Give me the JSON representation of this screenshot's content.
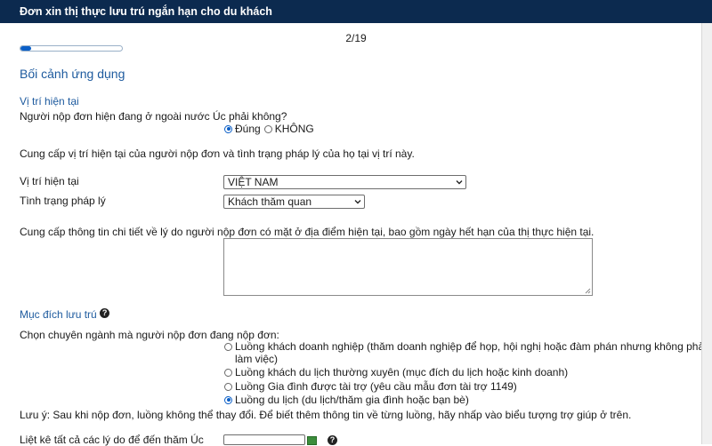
{
  "window": {
    "title": "Đơn xin thị thực lưu trú ngắn hạn cho du khách"
  },
  "progress": {
    "value": 0.105,
    "page": "2/19",
    "accent": "#0b5fc7"
  },
  "section": {
    "title": "Bối cảnh ứng dụng"
  },
  "location": {
    "heading": "Vị trí hiện tại",
    "question": "Người nộp đơn hiện đang ở ngoài nước Úc phải không?",
    "yes_label": "Đúng",
    "no_label": "KHÔNG",
    "selected": "yes",
    "instruction": "Cung cấp vị trí hiện tại của người nộp đơn và tình trạng pháp lý của họ tại vị trí này.",
    "location_label": "Vị trí hiện tại",
    "location_value": "VIỆT NAM",
    "status_label": "Tình trạng pháp lý",
    "status_value": "Khách thăm quan",
    "details_label": "Cung cấp thông tin chi tiết về lý do người nộp đơn có mặt ở địa điểm hiện tại, bao gồm ngày hết hạn của thị thực hiện tại.",
    "details_value": ""
  },
  "purpose": {
    "heading": "Mục đích lưu trú",
    "help_icon": "question-circle-icon",
    "prompt": "Chọn chuyên ngành mà người nộp đơn đang nộp đơn:",
    "options": [
      {
        "label": "Luồng khách doanh nghiệp (thăm doanh nghiệp để họp, hội nghị hoặc đàm phán nhưng không phải để",
        "label2": "làm việc)",
        "checked": false
      },
      {
        "label": "Luồng khách du lịch thường xuyên (mục đích du lịch hoặc kinh doanh)",
        "checked": false
      },
      {
        "label": "Luồng Gia đình được tài trợ (yêu cầu mẫu đơn tài trợ 1149)",
        "checked": false
      },
      {
        "label": "Luồng du lịch (du lịch/thăm gia đình hoặc bạn bè)",
        "checked": true
      }
    ],
    "note": "Lưu ý: Sau khi nộp đơn, luồng không thể thay đổi. Để biết thêm thông tin về từng luồng, hãy nhấp vào biểu tượng trợ giúp ở trên.",
    "reasons_label": "Liệt kê tất cả các lý do để đến thăm Úc"
  }
}
